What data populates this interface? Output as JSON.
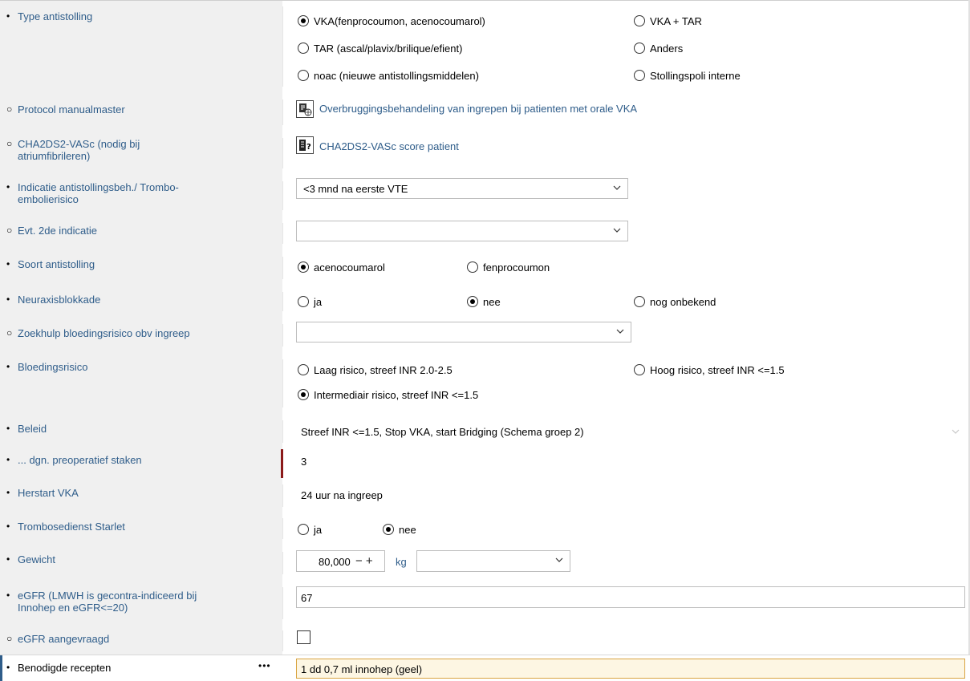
{
  "rows": {
    "type": {
      "bullet": "•",
      "label": "Type antistolling",
      "options": [
        "VKA(fenprocoumon, acenocoumarol)",
        "VKA + TAR",
        "TAR (ascal/plavix/brilique/efient)",
        "Anders",
        "noac (nieuwe antistollingsmiddelen)",
        "Stollingspoli interne"
      ]
    },
    "protocol": {
      "bullet": "○",
      "label": "Protocol manualmaster",
      "link": "Overbruggingsbehandeling van ingrepen bij patienten met orale VKA"
    },
    "cha2ds2": {
      "bullet": "○",
      "label": "CHA2DS2-VASc (nodig bij atriumfibrileren)",
      "link": "CHA2DS2-VASc score patient"
    },
    "indicatie": {
      "bullet": "•",
      "label": "Indicatie antistollingsbeh./ Trombo-embolierisico",
      "value": "<3 mnd na eerste VTE"
    },
    "indicatie2": {
      "bullet": "○",
      "label": "Evt. 2de indicatie",
      "value": ""
    },
    "soort": {
      "bullet": "•",
      "label": "Soort antistolling",
      "options": [
        "acenocoumarol",
        "fenprocoumon"
      ]
    },
    "neuraxis": {
      "bullet": "•",
      "label": "Neuraxisblokkade",
      "options": [
        "ja",
        "nee",
        "nog onbekend"
      ]
    },
    "zoekhulp": {
      "bullet": "○",
      "label": "Zoekhulp bloedingsrisico obv ingreep",
      "value": ""
    },
    "bloedingsrisico": {
      "bullet": "•",
      "label": "Bloedingsrisico",
      "options": [
        "Laag risico, streef INR 2.0-2.5",
        "Hoog risico, streef INR <=1.5",
        "Intermediair risico, streef INR <=1.5"
      ]
    },
    "beleid": {
      "bullet": "•",
      "label": "Beleid",
      "value": "Streef INR <=1.5, Stop VKA, start Bridging (Schema groep 2)"
    },
    "dgn": {
      "bullet": "•",
      "label": "... dgn. preoperatief staken",
      "value": "3"
    },
    "herstart": {
      "bullet": "•",
      "label": "Herstart VKA",
      "value": "24 uur na ingreep"
    },
    "trombosedienst": {
      "bullet": "•",
      "label": "Trombosedienst Starlet",
      "options": [
        "ja",
        "nee"
      ]
    },
    "gewicht": {
      "bullet": "•",
      "label": "Gewicht",
      "value": "80,000",
      "stepper": "− +",
      "unit": "kg",
      "unit_select": ""
    },
    "egfr": {
      "bullet": "•",
      "label": "eGFR (LMWH is gecontra-indiceerd bij Innohep en eGFR<=20)",
      "value": "67"
    },
    "egfr_aangevraagd": {
      "bullet": "○",
      "label": "eGFR aangevraagd"
    },
    "recepten": {
      "bullet": "•",
      "label": "Benodigde recepten",
      "more": "•••",
      "value": "1 dd 0,7 ml innohep (geel)"
    }
  },
  "selected": {
    "type": 0,
    "soort": 0,
    "neuraxis": 1,
    "bloedingsrisico": 2,
    "trombosedienst": 1,
    "egfr_aangevraagd": false
  },
  "icons": {
    "protocol": "document-globe-icon",
    "cha2ds2": "calculator-help-icon",
    "chevron": "chevron-down-icon"
  },
  "colors": {
    "label": "#2f5d8a",
    "accent_bar": "#8b1a1a",
    "focus_border": "#d9a441",
    "highlight_bg": "#fdf6e3"
  }
}
